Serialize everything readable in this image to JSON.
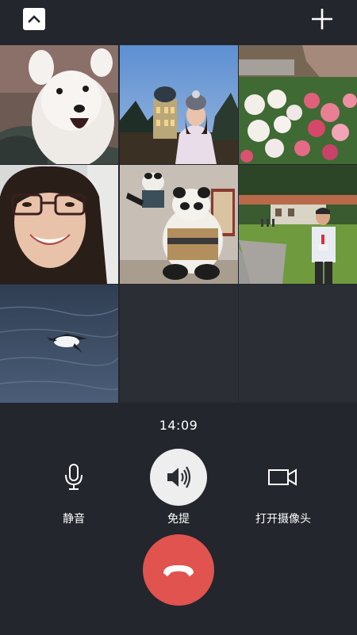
{
  "call": {
    "elapsed": "14:09"
  },
  "controls": {
    "mute_label": "静音",
    "speaker_label": "免提",
    "camera_label": "打开摄像头"
  },
  "icons": {
    "collapse": "chevron-up-icon",
    "add": "plus-icon",
    "mute": "microphone-icon",
    "speaker": "speaker-icon",
    "camera": "video-camera-icon",
    "hangup": "phone-hangup-icon"
  },
  "colors": {
    "background": "#23262c",
    "hangup": "#e0534f",
    "speaker_active": "#eeeeee"
  },
  "participants": [
    {
      "id": "white-dog"
    },
    {
      "id": "woman-night-castle"
    },
    {
      "id": "flowers"
    },
    {
      "id": "woman-glasses"
    },
    {
      "id": "panda-statue"
    },
    {
      "id": "man-park"
    },
    {
      "id": "seabird"
    }
  ]
}
